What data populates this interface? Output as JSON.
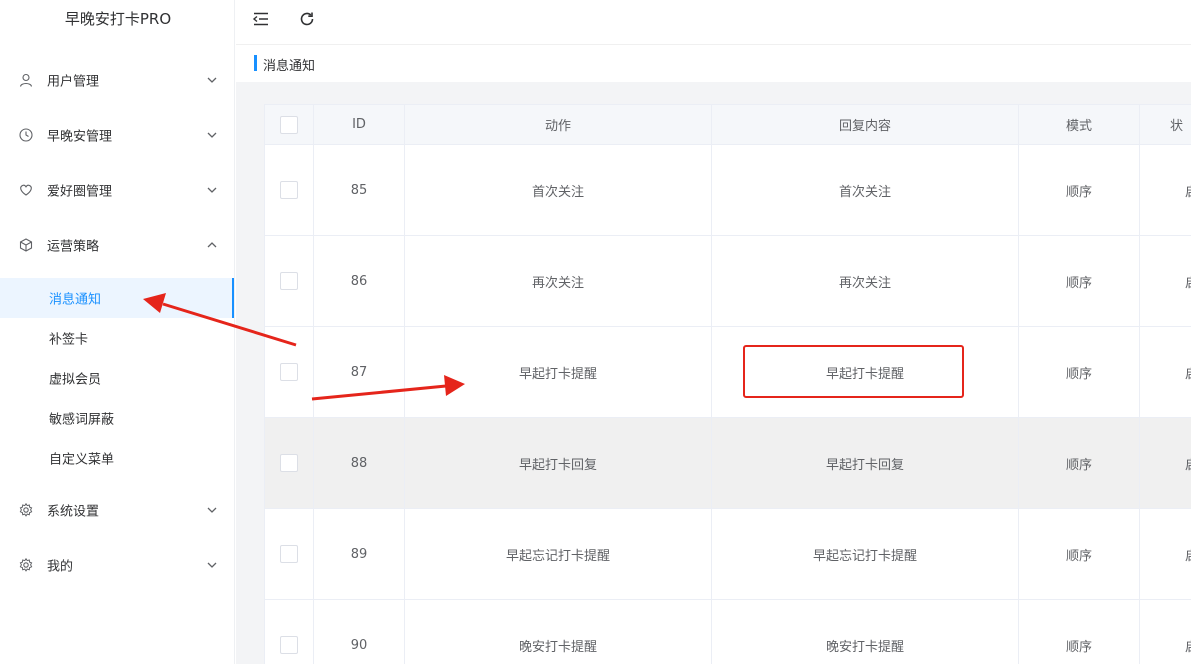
{
  "app": {
    "title": "早晚安打卡PRO"
  },
  "sidebar": {
    "menus": [
      {
        "label": "用户管理",
        "icon": "user-icon",
        "expanded": false
      },
      {
        "label": "早晚安管理",
        "icon": "clock-icon",
        "expanded": false
      },
      {
        "label": "爱好圈管理",
        "icon": "heart-icon",
        "expanded": false
      },
      {
        "label": "运营策略",
        "icon": "box-icon",
        "expanded": true
      }
    ],
    "submenu": [
      {
        "label": "消息通知",
        "active": true
      },
      {
        "label": "补签卡",
        "active": false
      },
      {
        "label": "虚拟会员",
        "active": false
      },
      {
        "label": "敏感词屏蔽",
        "active": false
      },
      {
        "label": "自定义菜单",
        "active": false
      }
    ],
    "bottom_menus": [
      {
        "label": "系统设置",
        "icon": "gear-icon"
      },
      {
        "label": "我的",
        "icon": "gear-icon"
      }
    ]
  },
  "header": {
    "page_title": "消息通知",
    "icons": [
      "collapse-menu-icon",
      "refresh-icon"
    ]
  },
  "table": {
    "columns": [
      "ID",
      "动作",
      "回复内容",
      "模式",
      "状"
    ],
    "rows": [
      {
        "id": "85",
        "action": "首次关注",
        "reply": "首次关注",
        "mode": "顺序",
        "status": "启"
      },
      {
        "id": "86",
        "action": "再次关注",
        "reply": "再次关注",
        "mode": "顺序",
        "status": "启"
      },
      {
        "id": "87",
        "action": "早起打卡提醒",
        "reply": "早起打卡提醒",
        "mode": "顺序",
        "status": "启"
      },
      {
        "id": "88",
        "action": "早起打卡回复",
        "reply": "早起打卡回复",
        "mode": "顺序",
        "status": "启"
      },
      {
        "id": "89",
        "action": "早起忘记打卡提醒",
        "reply": "早起忘记打卡提醒",
        "mode": "顺序",
        "status": "启"
      },
      {
        "id": "90",
        "action": "晚安打卡提醒",
        "reply": "晚安打卡提醒",
        "mode": "顺序",
        "status": "启"
      }
    ]
  },
  "colors": {
    "accent": "#1890ff",
    "mode": "#f07c2a",
    "status": "#8bc34a",
    "annotation": "#e5251b"
  }
}
